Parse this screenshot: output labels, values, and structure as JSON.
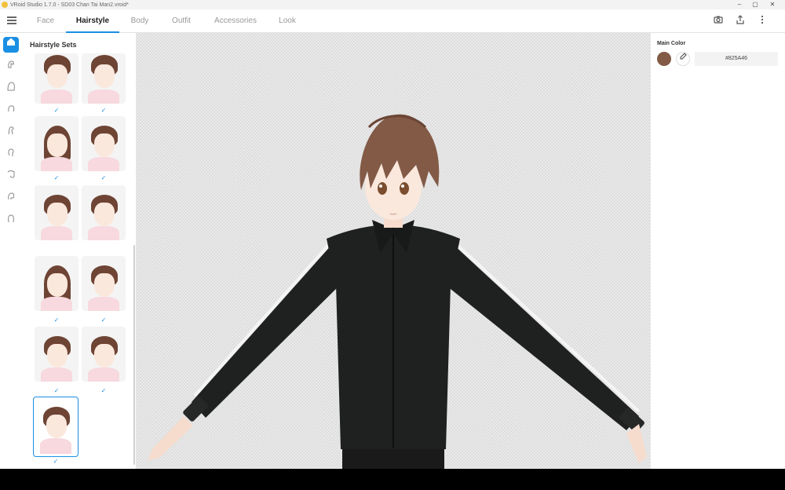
{
  "window": {
    "title": "VRoid Studio 1.7.0 - SD03 Chan Tai Man2.vroid*"
  },
  "nav": {
    "tabs": [
      {
        "label": "Face"
      },
      {
        "label": "Hairstyle"
      },
      {
        "label": "Body"
      },
      {
        "label": "Outfit"
      },
      {
        "label": "Accessories"
      },
      {
        "label": "Look"
      }
    ],
    "active_tab": "Hairstyle",
    "icons": [
      "camera-icon",
      "export-icon",
      "more-vert-icon"
    ]
  },
  "rail": {
    "items": [
      "hairstyle-sets-icon",
      "front-hair-icon",
      "back-hair-icon",
      "side-hair-icon",
      "ahoge-icon",
      "ponytail-icon",
      "braid-icon",
      "hair-accessory-icon",
      "base-hair-icon"
    ]
  },
  "hairstyle_panel": {
    "title": "Hairstyle Sets",
    "thumbnails": [
      {
        "checked": true
      },
      {
        "checked": true
      },
      {
        "checked": true
      },
      {
        "checked": true
      },
      {
        "checked": false
      },
      {
        "checked": false
      },
      {
        "checked": true
      },
      {
        "checked": true
      },
      {
        "checked": true
      },
      {
        "checked": true
      },
      {
        "checked": true,
        "selected": true
      }
    ]
  },
  "right_panel": {
    "main_color_label": "Main Color",
    "main_color_hex": "#825A46",
    "main_color_value": "#825A46"
  },
  "colors": {
    "accent": "#1a8fe3",
    "hair": "#825A46",
    "jacket": "#1c1e1d",
    "skin": "#fbe8dc"
  }
}
